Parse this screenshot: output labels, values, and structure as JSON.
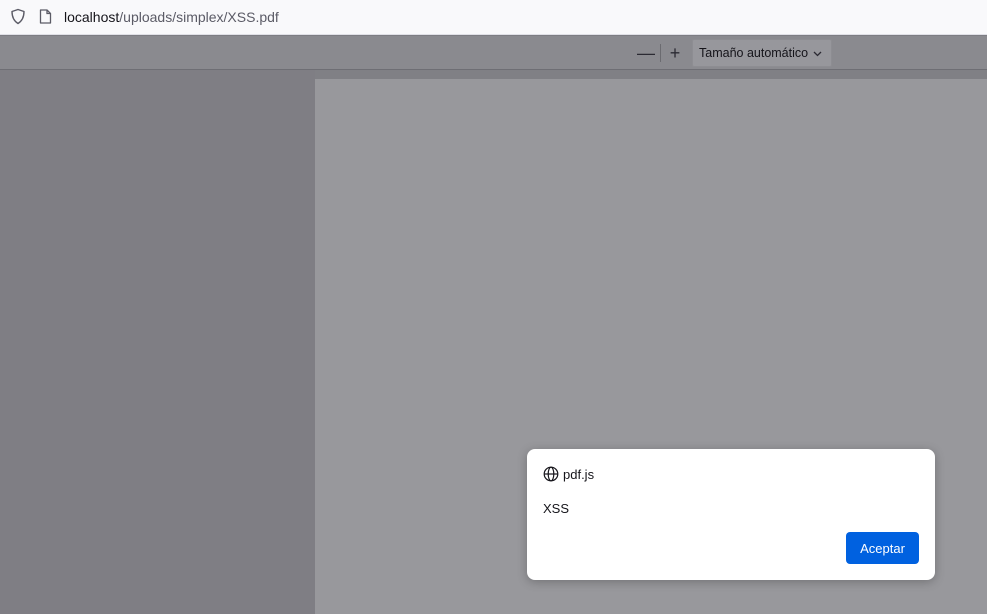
{
  "address_bar": {
    "host": "localhost",
    "path": "/uploads/simplex/XSS.pdf",
    "shield_icon": "shield-icon",
    "page_icon": "document-icon"
  },
  "toolbar": {
    "zoom_out_glyph": "—",
    "zoom_in_glyph": "+",
    "scale_value": "Tamaño automático"
  },
  "dialog": {
    "origin": "pdf.js",
    "message": "XSS",
    "ok_label": "Aceptar"
  },
  "colors": {
    "accent": "#0061e0",
    "toolbar": "#8a8a8f",
    "page": "#98989c"
  }
}
